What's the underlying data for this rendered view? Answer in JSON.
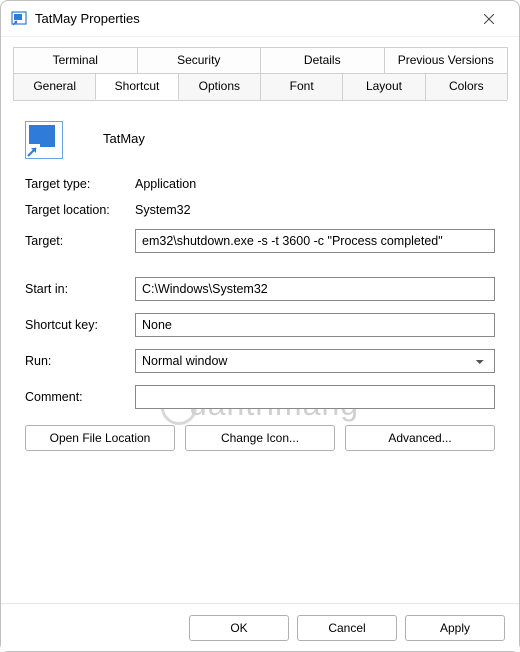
{
  "window": {
    "title": "TatMay Properties"
  },
  "tabs": {
    "row1": [
      "Terminal",
      "Security",
      "Details",
      "Previous Versions"
    ],
    "row2": [
      "General",
      "Shortcut",
      "Options",
      "Font",
      "Layout",
      "Colors"
    ],
    "active": "Shortcut"
  },
  "shortcut": {
    "name": "TatMay",
    "target_type_label": "Target type:",
    "target_type_value": "Application",
    "target_location_label": "Target location:",
    "target_location_value": "System32",
    "target_label": "Target:",
    "target_value": "em32\\shutdown.exe -s -t 3600 -c \"Process completed\"",
    "startin_label": "Start in:",
    "startin_value": "C:\\Windows\\System32",
    "shortcutkey_label": "Shortcut key:",
    "shortcutkey_value": "None",
    "run_label": "Run:",
    "run_value": "Normal window",
    "comment_label": "Comment:",
    "comment_value": ""
  },
  "buttons": {
    "open_location": "Open File Location",
    "change_icon": "Change Icon...",
    "advanced": "Advanced..."
  },
  "footer": {
    "ok": "OK",
    "cancel": "Cancel",
    "apply": "Apply"
  },
  "watermark": "uantrimang"
}
